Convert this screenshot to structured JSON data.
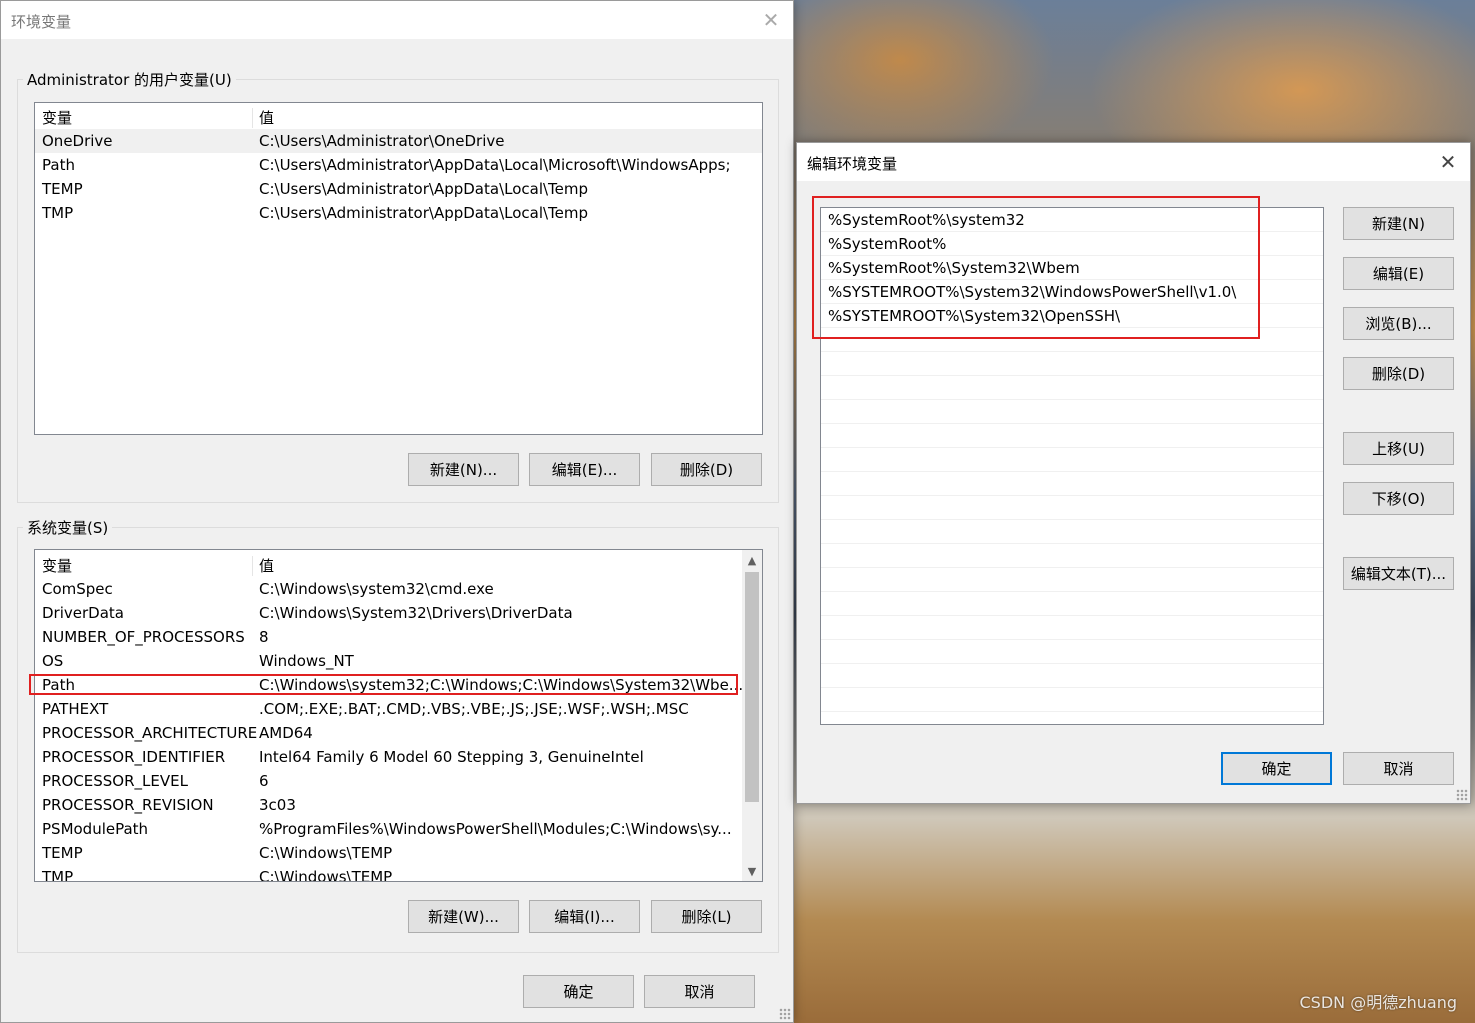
{
  "env_dialog": {
    "title": "环境变量",
    "user_group_label": "Administrator 的用户变量(U)",
    "user_vars": {
      "header": [
        "变量",
        "值"
      ],
      "rows": [
        [
          "OneDrive",
          "C:\\Users\\Administrator\\OneDrive"
        ],
        [
          "Path",
          "C:\\Users\\Administrator\\AppData\\Local\\Microsoft\\WindowsApps;"
        ],
        [
          "TEMP",
          "C:\\Users\\Administrator\\AppData\\Local\\Temp"
        ],
        [
          "TMP",
          "C:\\Users\\Administrator\\AppData\\Local\\Temp"
        ]
      ]
    },
    "user_buttons": {
      "new": "新建(N)...",
      "edit": "编辑(E)...",
      "delete": "删除(D)"
    },
    "system_group_label": "系统变量(S)",
    "system_vars": {
      "header": [
        "变量",
        "值"
      ],
      "rows": [
        [
          "ComSpec",
          "C:\\Windows\\system32\\cmd.exe"
        ],
        [
          "DriverData",
          "C:\\Windows\\System32\\Drivers\\DriverData"
        ],
        [
          "NUMBER_OF_PROCESSORS",
          "8"
        ],
        [
          "OS",
          "Windows_NT"
        ],
        [
          "Path",
          "C:\\Windows\\system32;C:\\Windows;C:\\Windows\\System32\\Wbe..."
        ],
        [
          "PATHEXT",
          ".COM;.EXE;.BAT;.CMD;.VBS;.VBE;.JS;.JSE;.WSF;.WSH;.MSC"
        ],
        [
          "PROCESSOR_ARCHITECTURE",
          "AMD64"
        ],
        [
          "PROCESSOR_IDENTIFIER",
          "Intel64 Family 6 Model 60 Stepping 3, GenuineIntel"
        ],
        [
          "PROCESSOR_LEVEL",
          "6"
        ],
        [
          "PROCESSOR_REVISION",
          "3c03"
        ],
        [
          "PSModulePath",
          "%ProgramFiles%\\WindowsPowerShell\\Modules;C:\\Windows\\sy..."
        ],
        [
          "TEMP",
          "C:\\Windows\\TEMP"
        ],
        [
          "TMP",
          "C:\\Windows\\TEMP"
        ]
      ]
    },
    "system_buttons": {
      "new": "新建(W)...",
      "edit": "编辑(I)...",
      "delete": "删除(L)"
    },
    "ok": "确定",
    "cancel": "取消"
  },
  "edit_dialog": {
    "title": "编辑环境变量",
    "entries": [
      "%SystemRoot%\\system32",
      "%SystemRoot%",
      "%SystemRoot%\\System32\\Wbem",
      "%SYSTEMROOT%\\System32\\WindowsPowerShell\\v1.0\\",
      "%SYSTEMROOT%\\System32\\OpenSSH\\"
    ],
    "buttons": {
      "new": "新建(N)",
      "edit": "编辑(E)",
      "browse": "浏览(B)...",
      "delete": "删除(D)",
      "move_up": "上移(U)",
      "move_down": "下移(O)",
      "edit_text": "编辑文本(T)..."
    },
    "ok": "确定",
    "cancel": "取消"
  },
  "watermark": "CSDN @明德zhuang",
  "colors": {
    "highlight": "#e02020",
    "default_button_border": "#0078d7"
  }
}
